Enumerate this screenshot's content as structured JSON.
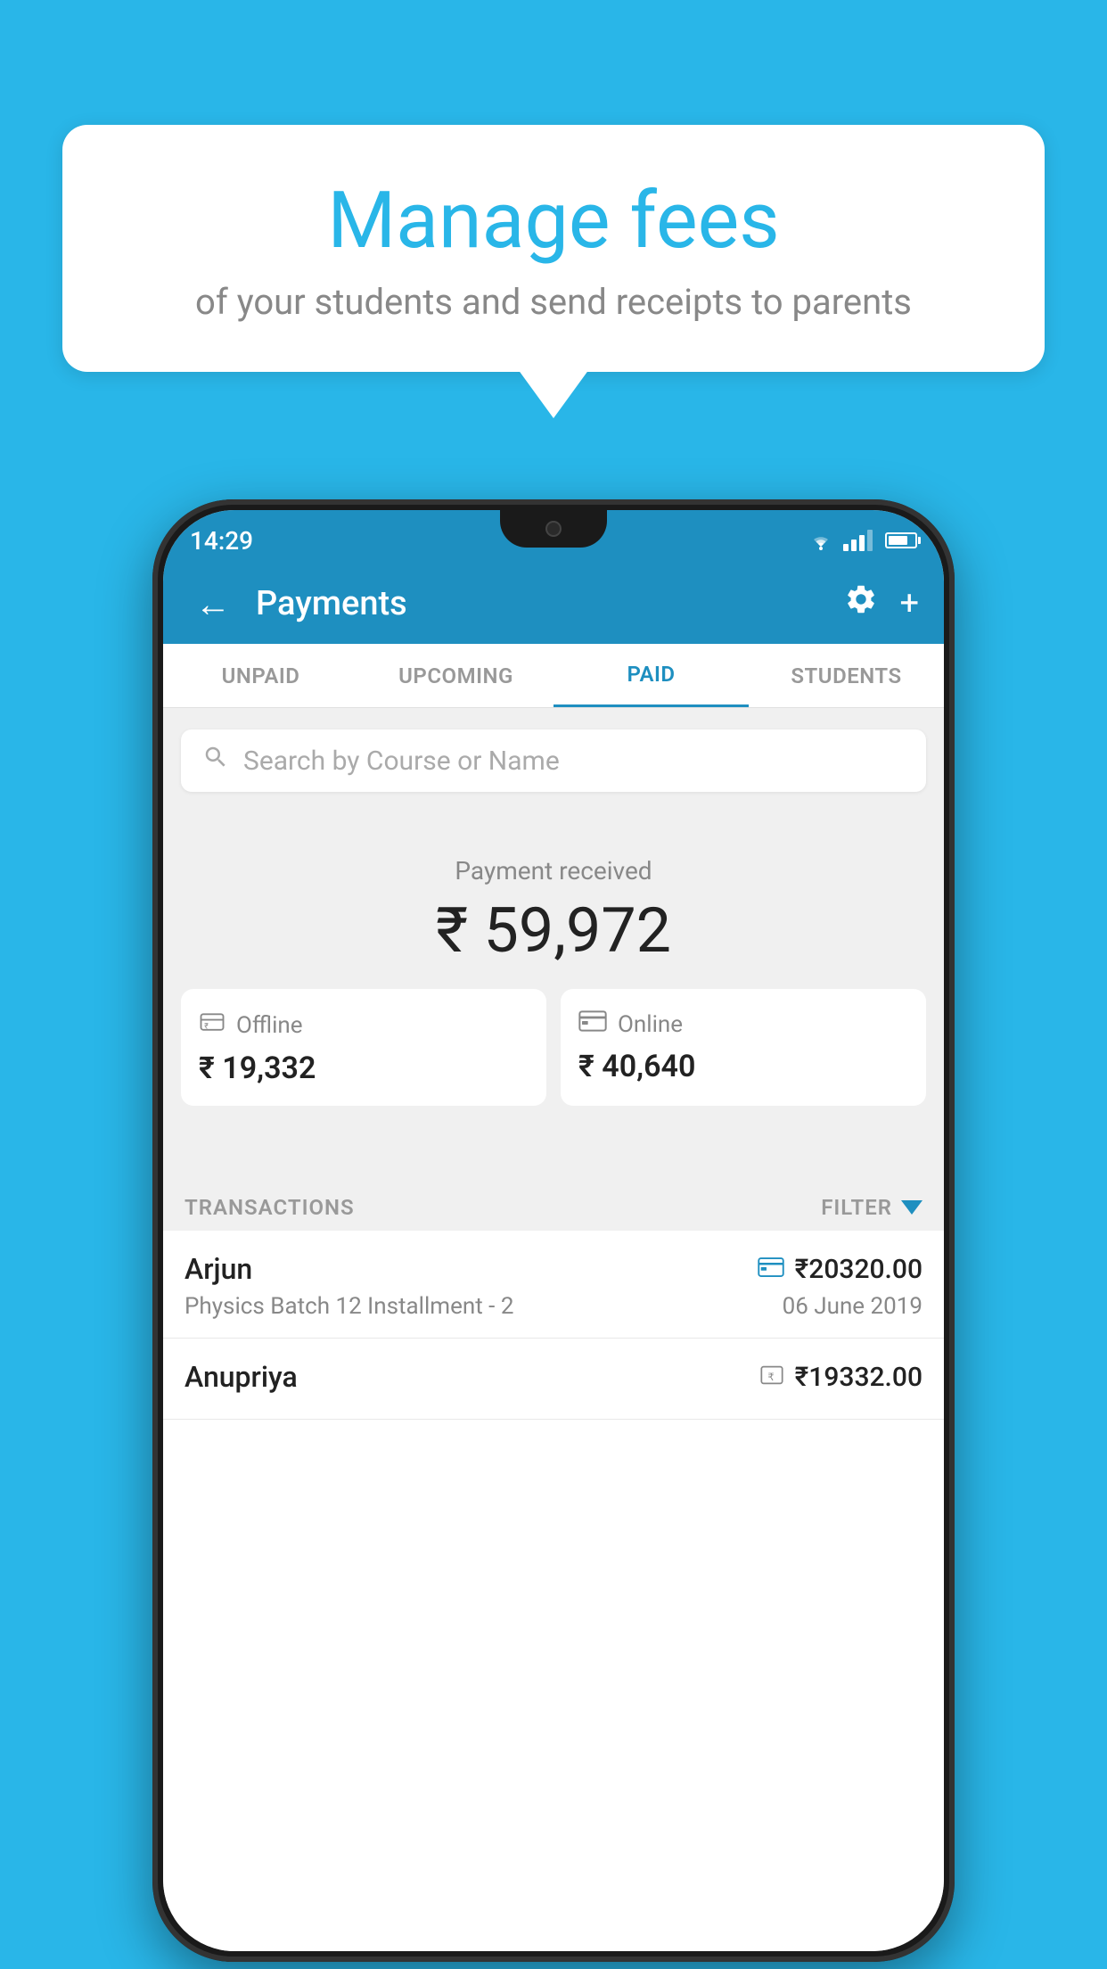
{
  "background": {
    "color": "#29b6e8"
  },
  "speech_bubble": {
    "title": "Manage fees",
    "subtitle": "of your students and send receipts to parents"
  },
  "phone": {
    "status_bar": {
      "time": "14:29"
    },
    "app_bar": {
      "title": "Payments",
      "back_label": "←",
      "plus_label": "+"
    },
    "tabs": [
      {
        "label": "UNPAID",
        "active": false
      },
      {
        "label": "UPCOMING",
        "active": false
      },
      {
        "label": "PAID",
        "active": true
      },
      {
        "label": "STUDENTS",
        "active": false
      }
    ],
    "search": {
      "placeholder": "Search by Course or Name"
    },
    "payment_summary": {
      "label": "Payment received",
      "amount": "₹ 59,972",
      "offline": {
        "label": "Offline",
        "amount": "₹ 19,332"
      },
      "online": {
        "label": "Online",
        "amount": "₹ 40,640"
      }
    },
    "transactions_header": {
      "label": "TRANSACTIONS",
      "filter_label": "FILTER"
    },
    "transactions": [
      {
        "name": "Arjun",
        "amount": "₹20320.00",
        "payment_type": "online",
        "course": "Physics Batch 12 Installment - 2",
        "date": "06 June 2019"
      },
      {
        "name": "Anupriya",
        "amount": "₹19332.00",
        "payment_type": "offline",
        "course": "",
        "date": ""
      }
    ]
  }
}
